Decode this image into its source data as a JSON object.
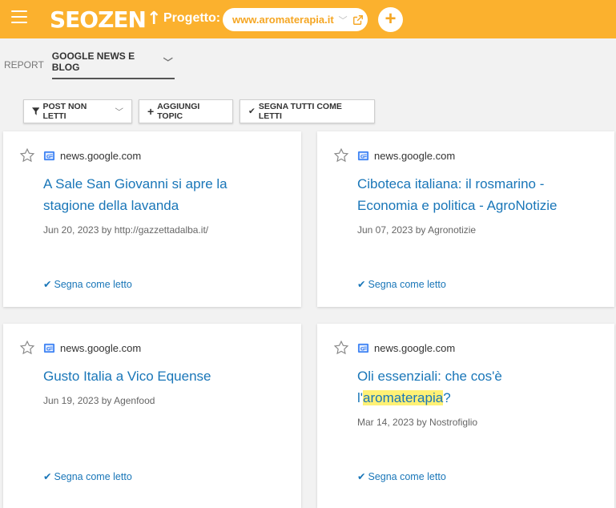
{
  "header": {
    "logo": "SEOZEN",
    "progetto_label": "Progetto:",
    "project_url": "www.aromaterapia.it",
    "add_label": "+"
  },
  "breadcrumb": {
    "report": "REPORT",
    "current": "GOOGLE NEWS E BLOG"
  },
  "toolbar": {
    "filter_label": "POST NON LETTI",
    "add_topic_label": "AGGIUNGI TOPIC",
    "mark_all_label": "SEGNA TUTTI COME LETTI"
  },
  "cards": [
    {
      "source": "news.google.com",
      "title": "A Sale San Giovanni si apre la stagione della lavanda",
      "meta": "Jun 20, 2023 by http://gazzettadalba.it/",
      "mark_label": "Segna come letto"
    },
    {
      "source": "news.google.com",
      "title": "Ciboteca italiana: il rosmarino - Economia e politica - AgroNotizie",
      "meta": "Jun 07, 2023 by Agronotizie",
      "mark_label": "Segna come letto"
    },
    {
      "source": "news.google.com",
      "title": "Gusto Italia a Vico Equense",
      "meta": "Jun 19, 2023 by Agenfood",
      "mark_label": "Segna come letto"
    },
    {
      "source": "news.google.com",
      "title_prefix": "Oli essenziali: che cos'è l'",
      "title_highlight": "aromaterapia",
      "title_suffix": "?",
      "meta": "Mar 14, 2023 by Nostrofiglio",
      "mark_label": "Segna come letto"
    }
  ],
  "colors": {
    "brand": "#fbb12e",
    "link": "#1976b8",
    "highlight": "#fff176"
  }
}
